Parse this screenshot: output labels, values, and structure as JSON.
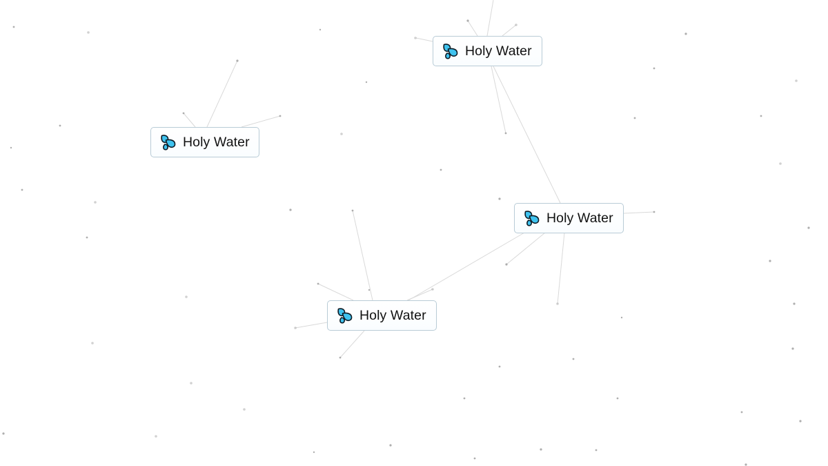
{
  "app": {
    "background": "#ffffff"
  },
  "element_tiles": [
    {
      "id": "t1",
      "label": "Holy Water",
      "icon": "water-drops-icon"
    },
    {
      "id": "t2",
      "label": "Holy Water",
      "icon": "water-drops-icon"
    },
    {
      "id": "t3",
      "label": "Holy Water",
      "icon": "water-drops-icon"
    },
    {
      "id": "t4",
      "label": "Holy Water",
      "icon": "water-drops-icon"
    }
  ],
  "colors": {
    "tile_border": "#b8cbd6",
    "drop_fill": "#3fc3ef",
    "drop_outline": "#0d1b25",
    "particle": "#9a9a9a",
    "line": "#d9d9d9"
  }
}
